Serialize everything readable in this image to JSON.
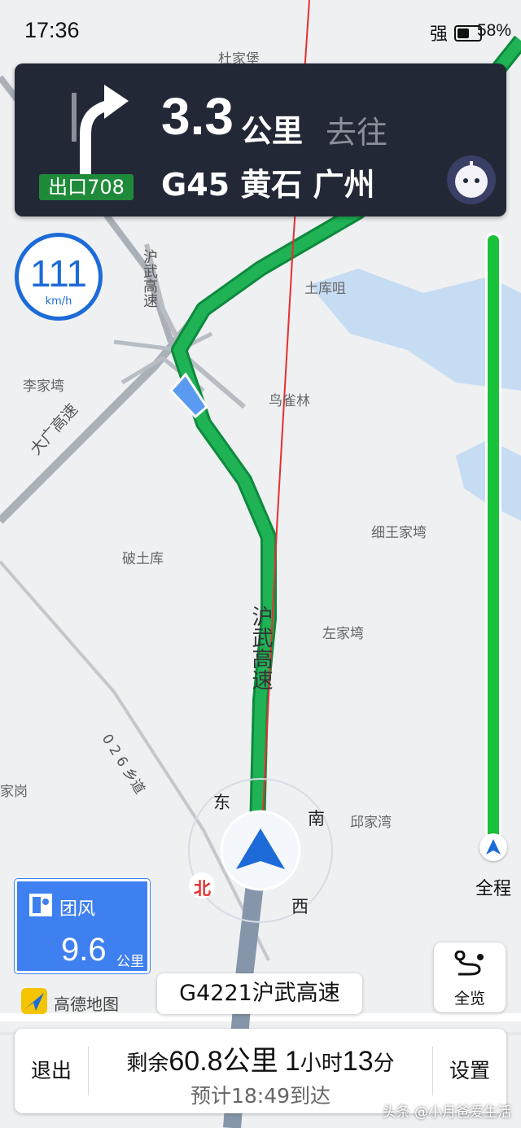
{
  "status_bar": {
    "time": "17:36",
    "signal": "强",
    "battery": "58%"
  },
  "guidance": {
    "exit": "出口708",
    "distance": "3.3",
    "distance_unit": "公里",
    "goto": "去往",
    "road": "G45 黄石 广州"
  },
  "speed": {
    "value": "111",
    "unit": "km/h"
  },
  "progress": {
    "label": "全程"
  },
  "sign": {
    "name": "团风",
    "distance": "9.6",
    "unit": "公里"
  },
  "brand": "高德地图",
  "current_road": "G4221沪武高速",
  "overview_label": "全览",
  "bottom": {
    "exit": "退出",
    "remaining_prefix": "剩余",
    "remaining_distance": "60.8公里",
    "remaining_time_h": "1",
    "remaining_time_h_unit": "小时",
    "remaining_time_m": "13",
    "remaining_time_m_unit": "分",
    "eta": "预计18:49到达",
    "settings": "设置"
  },
  "compass": {
    "east": "东",
    "south": "南",
    "north": "北",
    "west": "西"
  },
  "map_labels": {
    "dujiabao": "杜家堡",
    "tukuming": "土库咀",
    "lijiawan": "李家塆",
    "niaoquelin": "鸟雀林",
    "xiwangjiawan": "细王家塆",
    "potuku": "破土库",
    "zuojiawan": "左家塆",
    "qiujiawan": "邱家湾",
    "jiagang": "家岗",
    "huwu_vertical": "沪武高速",
    "dadguang": "大广高速",
    "huwu_top": "沪武高速",
    "road026": "0 2 6 乡道"
  },
  "watermark": "头条 @小月爸爱生活"
}
